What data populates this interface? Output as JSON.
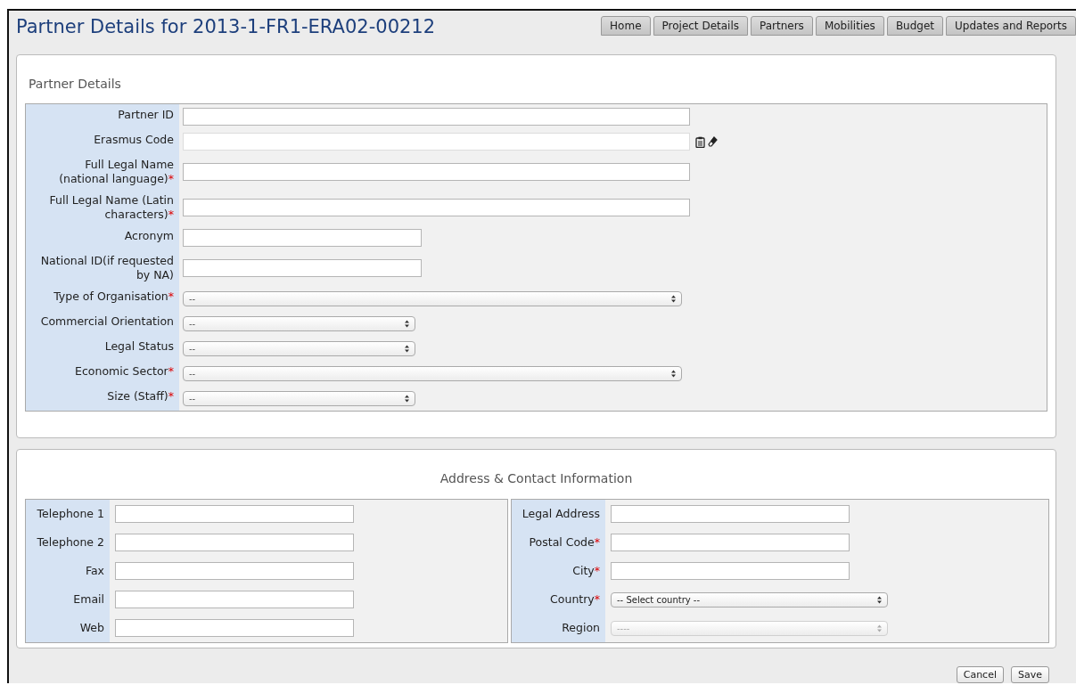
{
  "title": "Partner Details for 2013-1-FR1-ERA02-00212",
  "nav": [
    {
      "label": "Home"
    },
    {
      "label": "Project Details"
    },
    {
      "label": "Partners"
    },
    {
      "label": "Mobilities"
    },
    {
      "label": "Budget"
    },
    {
      "label": "Updates and Reports"
    }
  ],
  "required_mark": "*",
  "partner_details": {
    "heading": "Partner Details",
    "fields": [
      {
        "label": "Partner ID",
        "kind": "text",
        "wide": true,
        "required": false
      },
      {
        "label": "Erasmus Code",
        "kind": "text_tools",
        "wide": true,
        "required": false
      },
      {
        "label": "Full Legal Name (national language)",
        "kind": "text",
        "wide": true,
        "required": true
      },
      {
        "label": "Full Legal Name (Latin characters)",
        "kind": "text",
        "wide": true,
        "required": true
      },
      {
        "label": "Acronym",
        "kind": "text",
        "wide": false,
        "required": false
      },
      {
        "label": "National ID(if requested by NA)",
        "kind": "text",
        "wide": false,
        "required": false
      },
      {
        "label": "Type of Organisation",
        "kind": "select",
        "wide": true,
        "required": true,
        "value": "--"
      },
      {
        "label": "Commercial Orientation",
        "kind": "select",
        "wide": false,
        "required": false,
        "value": "--"
      },
      {
        "label": "Legal Status",
        "kind": "select",
        "wide": false,
        "required": false,
        "value": "--"
      },
      {
        "label": "Economic Sector",
        "kind": "select",
        "wide": true,
        "required": true,
        "value": "--"
      },
      {
        "label": "Size (Staff)",
        "kind": "select",
        "wide": false,
        "required": true,
        "value": "--"
      }
    ]
  },
  "address": {
    "heading": "Address & Contact Information",
    "left": [
      {
        "label": "Telephone 1",
        "kind": "text",
        "required": false
      },
      {
        "label": "Telephone 2",
        "kind": "text",
        "required": false
      },
      {
        "label": "Fax",
        "kind": "text",
        "required": false
      },
      {
        "label": "Email",
        "kind": "text",
        "required": false
      },
      {
        "label": "Web",
        "kind": "text",
        "required": false
      }
    ],
    "right": [
      {
        "label": "Legal Address",
        "kind": "text",
        "required": false
      },
      {
        "label": "Postal Code",
        "kind": "text",
        "required": true
      },
      {
        "label": "City",
        "kind": "text",
        "required": true
      },
      {
        "label": "Country",
        "kind": "select",
        "required": true,
        "value": "-- Select country --",
        "disabled": false
      },
      {
        "label": "Region",
        "kind": "select",
        "required": false,
        "value": "----",
        "disabled": true
      }
    ]
  },
  "buttons": [
    {
      "label": "Cancel"
    },
    {
      "label": "Save"
    }
  ]
}
